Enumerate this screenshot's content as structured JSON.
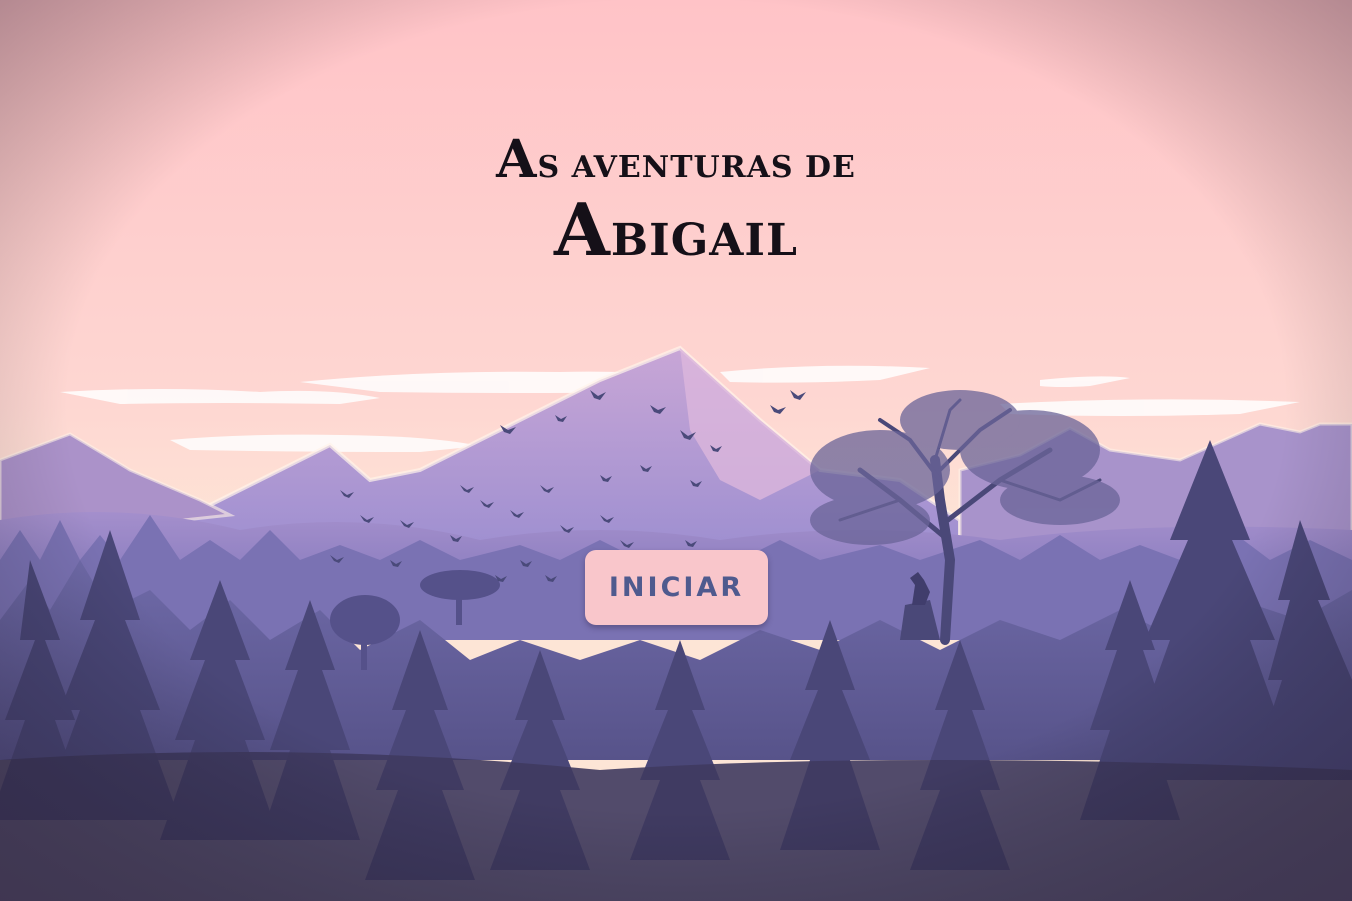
{
  "title": {
    "line1_initial": "A",
    "line1_rest": "S AVENTURAS DE",
    "line2_initial": "A",
    "line2_rest": "BIGAIL"
  },
  "start_button": {
    "label": "INICIAR"
  },
  "colors": {
    "sky_top": "#ffc4c7",
    "sky_bottom": "#fce0d4",
    "mountain": "#b9a4d6",
    "forest": "#4b4876",
    "button_bg": "#f9c6cb",
    "button_text": "#4f5a8e",
    "title_text": "#151018"
  }
}
